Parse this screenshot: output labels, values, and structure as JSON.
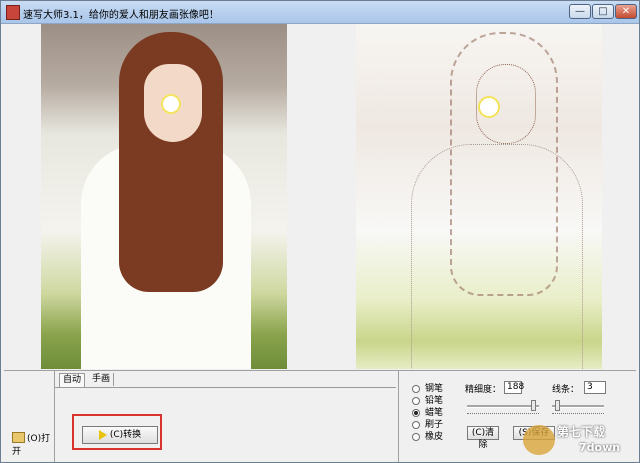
{
  "window": {
    "title": "速写大师3.1，给你的爱人和朋友画张像吧！",
    "controls": {
      "minimize": "—",
      "maximize": "□",
      "close": "✕"
    }
  },
  "left_panel": {
    "open_button": "(O)打开",
    "open_icon": "folder-icon"
  },
  "tabs": [
    {
      "label": "自动"
    },
    {
      "label": "手画"
    }
  ],
  "convert_button": {
    "label": "(C)转换",
    "icon": "play-icon"
  },
  "brush_options": [
    {
      "label": "钢笔",
      "selected": false
    },
    {
      "label": "铅笔",
      "selected": false
    },
    {
      "label": "蜡笔",
      "selected": true
    },
    {
      "label": "刷子",
      "selected": false
    },
    {
      "label": "橡皮",
      "selected": false
    }
  ],
  "detail": {
    "label": "精细度：",
    "value": "188"
  },
  "lines": {
    "label": "线条：",
    "value": "3"
  },
  "buttons": {
    "clear": "(C)清除",
    "save": "(S)保存"
  },
  "watermark": {
    "name": "第七下载",
    "sub": "7down"
  },
  "colors": {
    "highlight": "#d7322d",
    "title_bar": "#b7d0ee"
  }
}
